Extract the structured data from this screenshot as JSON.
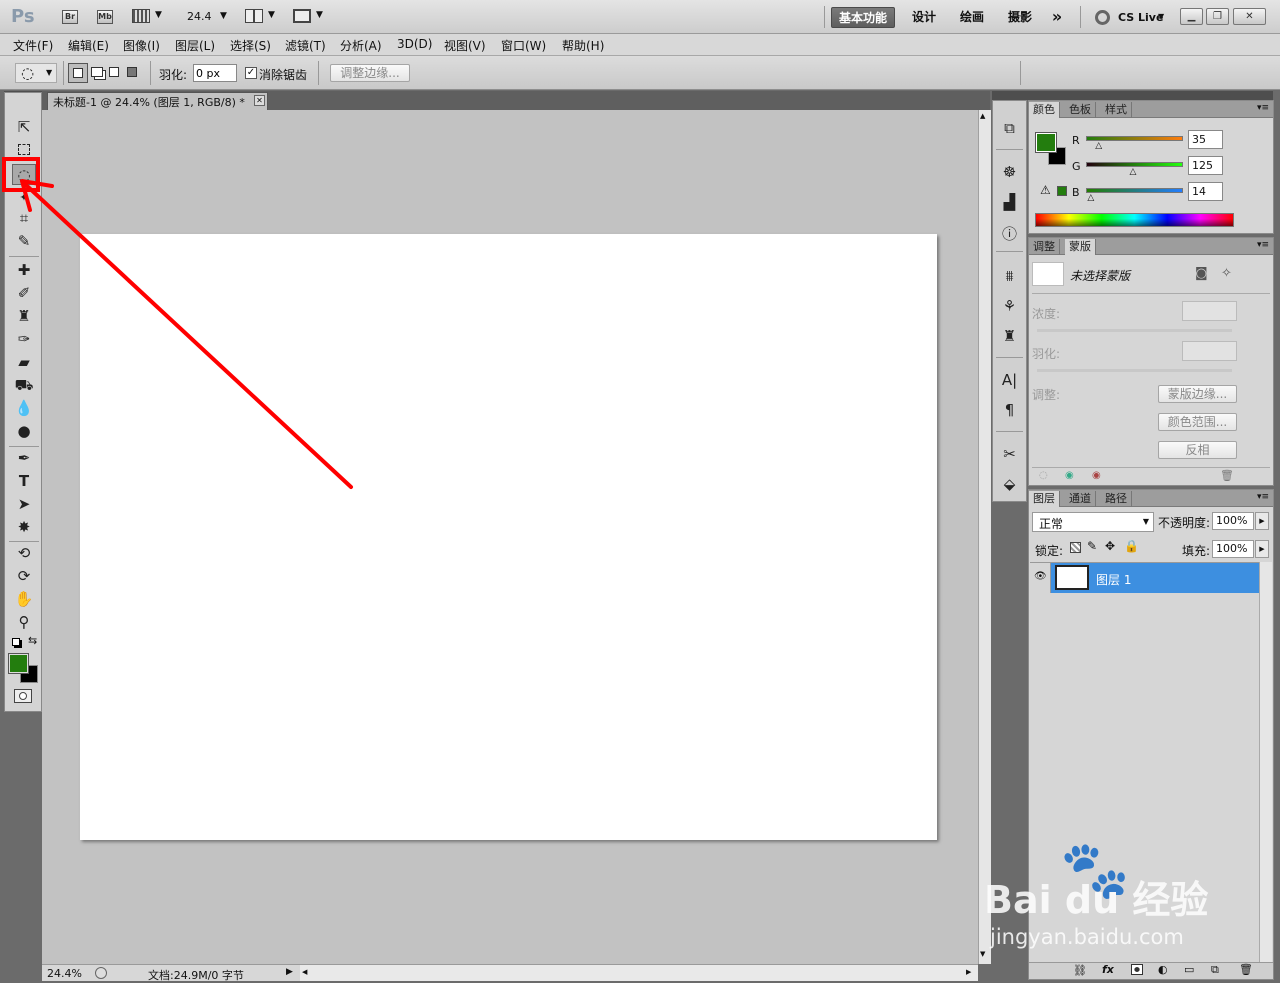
{
  "app": {
    "logo": "Ps",
    "zoom_value": "24.4"
  },
  "workspaces": {
    "active": "基本功能",
    "items": [
      "设计",
      "绘画",
      "摄影"
    ],
    "more": "»",
    "cslive": "CS Live"
  },
  "menu": [
    "文件(F)",
    "编辑(E)",
    "图像(I)",
    "图层(L)",
    "选择(S)",
    "滤镜(T)",
    "分析(A)",
    "3D(D)",
    "视图(V)",
    "窗口(W)",
    "帮助(H)"
  ],
  "options": {
    "feather_label": "羽化:",
    "feather_value": "0 px",
    "antialias_label": "消除锯齿",
    "antialias_checked": true,
    "refine_edge_label": "调整边缘..."
  },
  "document": {
    "tab_title": "未标题-1 @ 24.4% (图层 1, RGB/8) *",
    "zoom_status": "24.4%",
    "doc_status": "文档:24.9M/0 字节"
  },
  "color_panel": {
    "tabs": [
      "颜色",
      "色板",
      "样式"
    ],
    "channels": [
      {
        "label": "R",
        "value": "35",
        "fraction": 0.137
      },
      {
        "label": "G",
        "value": "125",
        "fraction": 0.49
      },
      {
        "label": "B",
        "value": "14",
        "fraction": 0.055
      }
    ],
    "foreground": "#237d0e",
    "background": "#000000"
  },
  "masks_panel": {
    "tabs": [
      "调整",
      "蒙版"
    ],
    "no_mask_label": "未选择蒙版",
    "density_label": "浓度:",
    "feather_label": "羽化:",
    "refine_label": "调整:",
    "mask_edge_button": "蒙版边缘...",
    "color_range_button": "颜色范围...",
    "invert_button": "反相"
  },
  "layers_panel": {
    "tabs": [
      "图层",
      "通道",
      "路径"
    ],
    "blend_mode": "正常",
    "opacity_label": "不透明度:",
    "opacity_value": "100%",
    "lock_label": "锁定:",
    "fill_label": "填充:",
    "fill_value": "100%",
    "layers": [
      {
        "name": "图层 1",
        "visible": true,
        "selected": true
      }
    ]
  },
  "watermark": {
    "brand": "Bai du 经验",
    "url": "jingyan.baidu.com"
  },
  "colors": {
    "accent_selection": "#3d8fe0",
    "annotation_red": "#ff0000"
  }
}
